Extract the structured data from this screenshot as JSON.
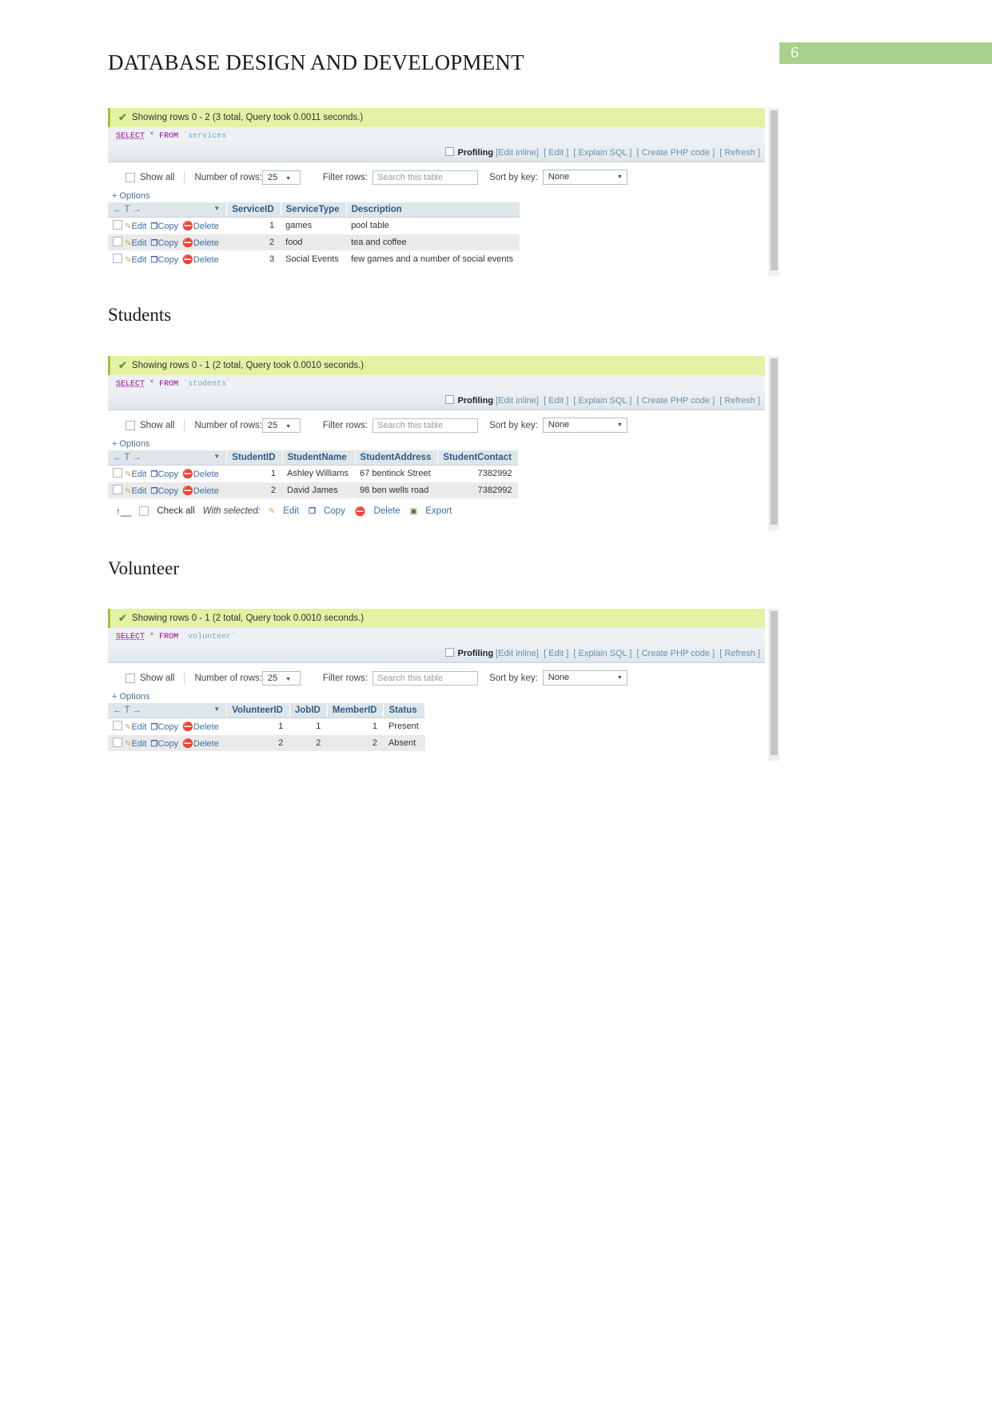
{
  "document": {
    "title": "DATABASE DESIGN AND DEVELOPMENT",
    "page_number": "6",
    "accent_green": "#a9d18e"
  },
  "sections": [
    {
      "heading": "Students"
    },
    {
      "heading": "Volunteer"
    }
  ],
  "common": {
    "show_all_label": "Show all",
    "number_of_rows_label": "Number of rows:",
    "number_of_rows_value": "25",
    "filter_rows_label": "Filter rows:",
    "filter_placeholder": "Search this table",
    "sort_by_key_label": "Sort by key:",
    "sort_by_key_value": "None",
    "options_link": "+ Options",
    "profiling_label": "Profiling",
    "link_edit_inline": "[Edit inline]",
    "link_edit": "[ Edit ]",
    "link_explain_sql": "[ Explain SQL ]",
    "link_create_php": "[ Create PHP code ]",
    "link_refresh": "[ Refresh ]",
    "action_edit": "Edit",
    "action_copy": "Copy",
    "action_delete": "Delete",
    "nav_header": "← T →",
    "check_all_label": "Check all",
    "with_selected_label": "With selected:",
    "footer_edit": "Edit",
    "footer_copy": "Copy",
    "footer_delete": "Delete",
    "footer_export": "Export"
  },
  "panels": [
    {
      "id": "services",
      "status": "Showing rows 0 - 2 (3 total, Query took 0.0011 seconds.)",
      "sql_keyword": "SELECT",
      "sql_star": "*",
      "sql_from": "FROM",
      "sql_table": "`services`",
      "columns": [
        "ServiceID",
        "ServiceType",
        "Description"
      ],
      "rows": [
        {
          "cells": [
            "1",
            "games",
            "pool table"
          ]
        },
        {
          "cells": [
            "2",
            "food",
            "tea and coffee"
          ]
        },
        {
          "cells": [
            "3",
            "Social Events",
            "few games and a number of social events"
          ]
        }
      ],
      "has_footer": false
    },
    {
      "id": "students",
      "status": "Showing rows 0 - 1 (2 total, Query took 0.0010 seconds.)",
      "sql_keyword": "SELECT",
      "sql_star": "*",
      "sql_from": "FROM",
      "sql_table": "`students`",
      "columns": [
        "StudentID",
        "StudentName",
        "StudentAddress",
        "StudentContact"
      ],
      "rows": [
        {
          "cells": [
            "1",
            "Ashley Williams",
            "67 bentinck Street",
            "7382992"
          ]
        },
        {
          "cells": [
            "2",
            "David James",
            "98 ben wells road",
            "7382992"
          ]
        }
      ],
      "has_footer": true
    },
    {
      "id": "volunteer",
      "status": "Showing rows 0 - 1 (2 total, Query took 0.0010 seconds.)",
      "sql_keyword": "SELECT",
      "sql_star": "*",
      "sql_from": "FROM",
      "sql_table": "`volunteer`",
      "columns": [
        "VolunteerID",
        "JobID",
        "MemberID",
        "Status"
      ],
      "rows": [
        {
          "cells": [
            "1",
            "1",
            "1",
            "Present"
          ]
        },
        {
          "cells": [
            "2",
            "2",
            "2",
            "Absent"
          ]
        }
      ],
      "has_footer": false
    }
  ]
}
